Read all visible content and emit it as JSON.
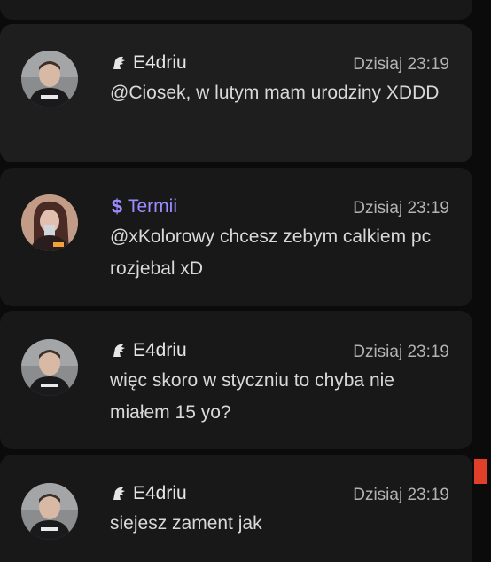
{
  "messages": [
    {
      "author": "E4driu",
      "author_icon": "helmet-icon",
      "time": "Dzisiaj 23:19",
      "text": "@Ciosek, w lutym mam urodziny XDDD"
    },
    {
      "author": "Termii",
      "author_icon": "dollar-icon",
      "author_color": "#9a8cff",
      "time": "Dzisiaj 23:19",
      "text": "@xKolorowy chcesz zebym calkiem pc rozjebal xD"
    },
    {
      "author": "E4driu",
      "author_icon": "helmet-icon",
      "time": "Dzisiaj 23:19",
      "text": "więc skoro w styczniu to chyba nie miałem 15 yo?"
    },
    {
      "author": "E4driu",
      "author_icon": "helmet-icon",
      "time": "Dzisiaj 23:19",
      "text": "siejesz zament jak"
    }
  ],
  "colors": {
    "background": "#0b0b0c",
    "card": "#181819",
    "accent_scroll": "#e0402a"
  }
}
